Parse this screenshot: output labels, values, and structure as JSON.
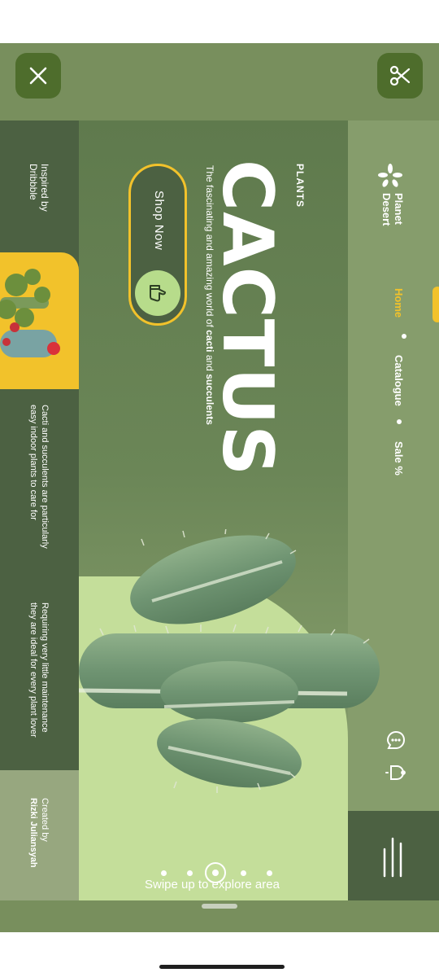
{
  "viewer": {
    "close_icon": "close-icon",
    "cut_icon": "scissors-icon"
  },
  "brand": {
    "name_line1": "Planet",
    "name_line2": "Desert",
    "logo_icon": "star-cluster-icon"
  },
  "nav": {
    "items": [
      {
        "label": "Home",
        "active": true,
        "color": "#f2c22b"
      },
      {
        "label": "Catalogue",
        "active": false
      },
      {
        "label": "Sale %",
        "active": false
      }
    ]
  },
  "hero": {
    "kicker": "PLANTS",
    "title": "CACTUS",
    "subtitle_pre": "The fascinating and amazing world of ",
    "subtitle_bold1": "cacti",
    "subtitle_mid": " and ",
    "subtitle_bold2": "succulents",
    "cta_label": "Shop Now",
    "cta_icon": "thumbs-up-icon"
  },
  "sidebar": {
    "inspired_line1": "Inspired by",
    "inspired_line2": "Dribbble",
    "desc1_line1": "Cacti and succulents are particularly",
    "desc1_line2": "easy indoor plants to care for",
    "desc2_line1": "Requiring very little maintenance",
    "desc2_line2": "they are ideal for every plant lover",
    "created_line1": "Created by",
    "created_line2": "Rizki Juliansyah"
  },
  "actions": {
    "chat_icon": "chat-bubble-icon",
    "bell_icon": "bell-icon",
    "menu_icon": "menu-lines-icon"
  },
  "footer": {
    "swipe_text": "Swipe up to explore area",
    "pager_total": 5,
    "pager_active": 3
  },
  "colors": {
    "accent": "#f2c22b",
    "dark_green": "#4c6142",
    "light_green": "#c4de9a",
    "button_green": "#4e6d2c"
  }
}
